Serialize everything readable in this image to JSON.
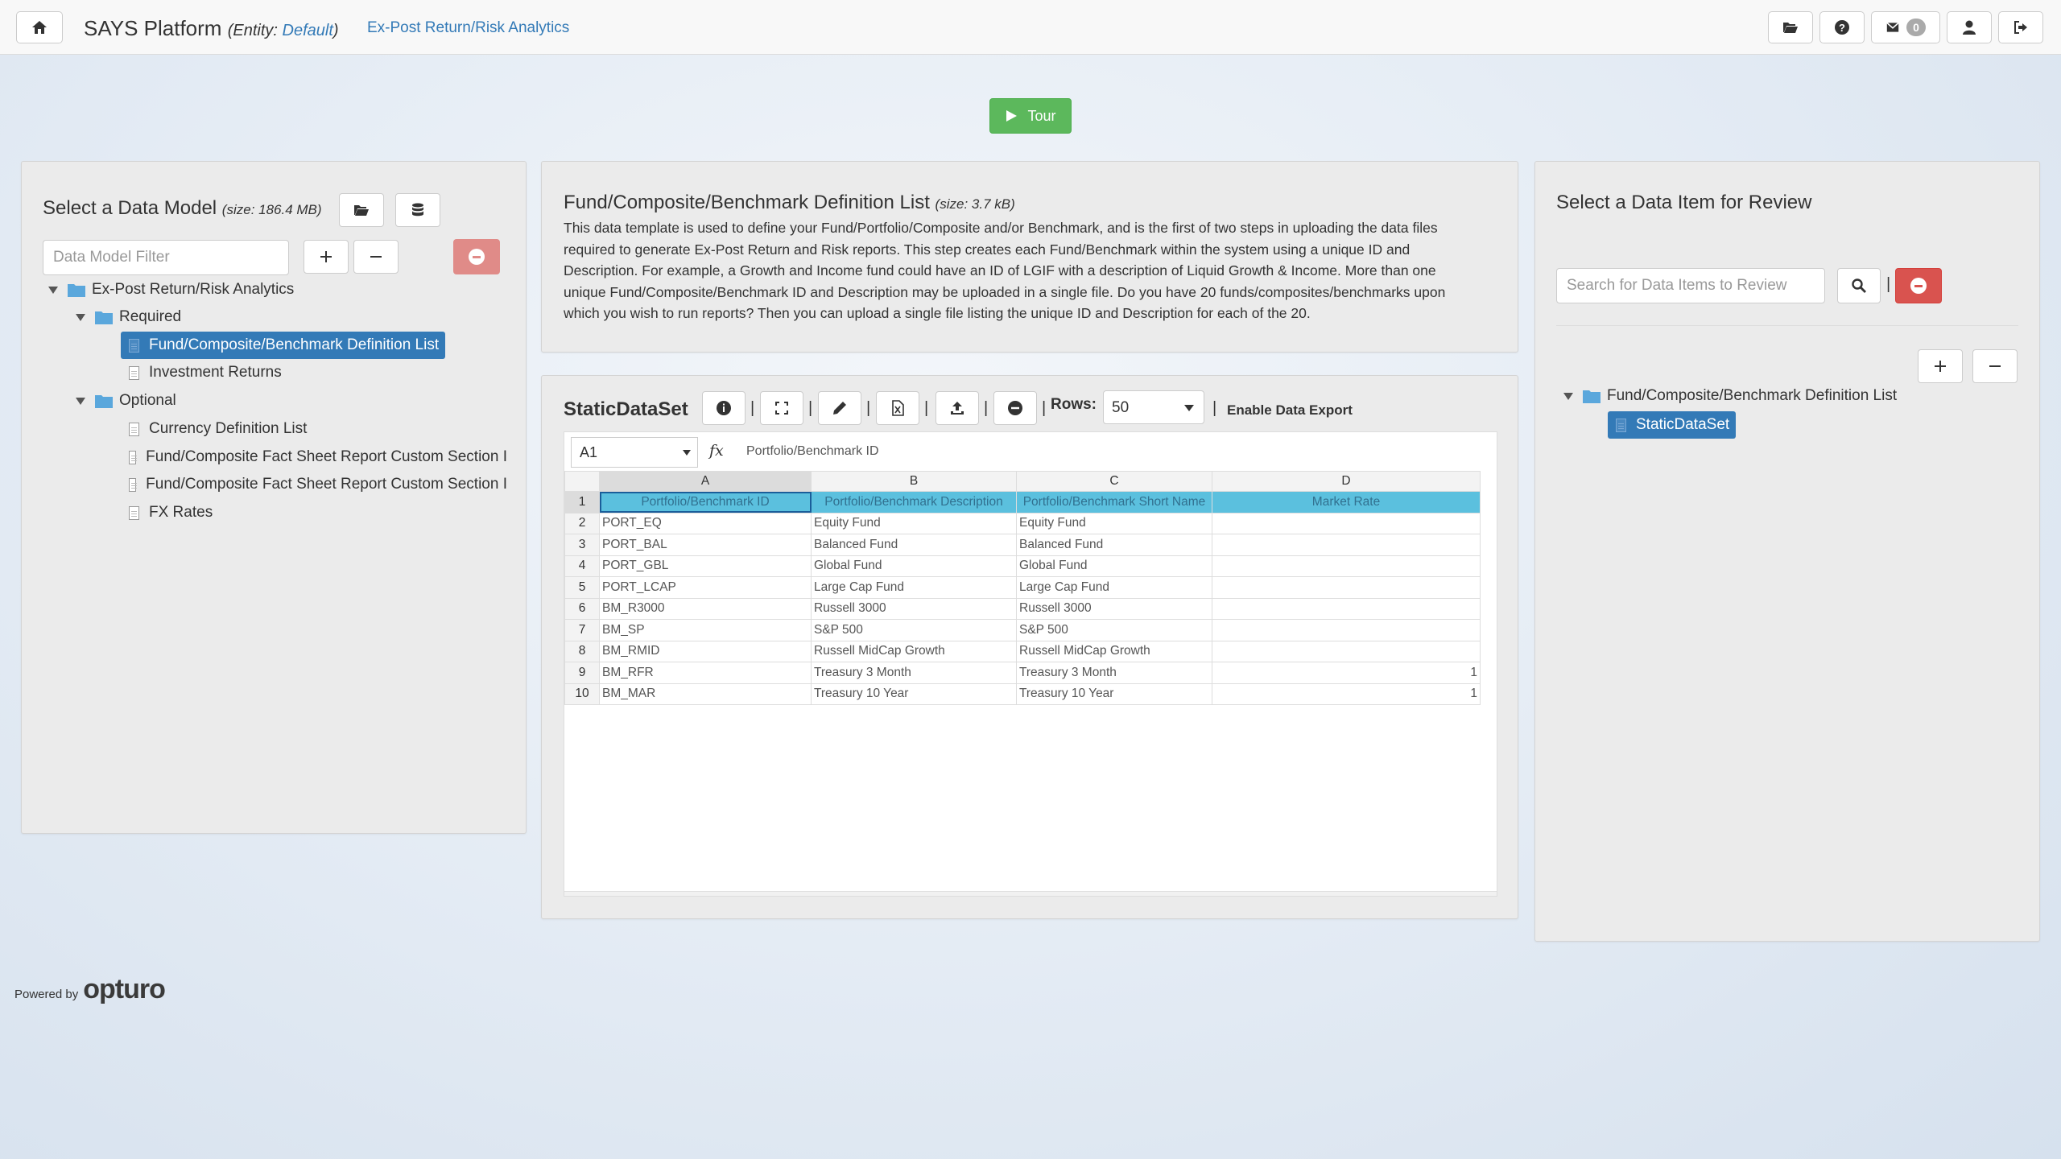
{
  "navbar": {
    "brand": "SAYS Platform",
    "entity_prefix": "(Entity: ",
    "entity_value": "Default",
    "entity_suffix": ")",
    "breadcrumb": "Ex-Post Return/Risk Analytics",
    "mail_count": "0"
  },
  "tour": {
    "label": "Tour"
  },
  "left_panel": {
    "title": "Select a Data Model",
    "size": "(size: 186.4 MB)",
    "filter_placeholder": "Data Model Filter",
    "tree": [
      {
        "label": "Ex-Post Return/Risk Analytics",
        "type": "folder"
      },
      {
        "label": "Required",
        "type": "folder"
      },
      {
        "label": "Fund/Composite/Benchmark Definition List",
        "type": "file",
        "selected": true
      },
      {
        "label": "Investment Returns",
        "type": "file"
      },
      {
        "label": "Optional",
        "type": "folder"
      },
      {
        "label": "Currency Definition List",
        "type": "file"
      },
      {
        "label": "Fund/Composite Fact Sheet Report Custom Section I",
        "type": "file"
      },
      {
        "label": "Fund/Composite Fact Sheet Report Custom Section I",
        "type": "file"
      },
      {
        "label": "FX Rates",
        "type": "file"
      }
    ]
  },
  "center_panel": {
    "title": "Fund/Composite/Benchmark Definition List",
    "size": "(size: 3.7 kB)",
    "description": "This data template is used to define your Fund/Portfolio/Composite and/or Benchmark, and is the first of two steps in uploading the data files required to generate Ex-Post Return and Risk reports. This step creates each Fund/Benchmark within the system using a unique ID and Description. For example, a Growth and Income fund could have an ID of LGIF with a description of Liquid Growth & Income. More than one unique Fund/Composite/Benchmark ID and Description may be uploaded in a single file. Do you have 20 funds/composites/benchmarks upon which you wish to run reports? Then you can upload a single file listing the unique ID and Description for each of the 20.",
    "dataset_title": "StaticDataSet",
    "separator": "|",
    "rows_label": "Rows:",
    "rows_value": "50",
    "export_label": "Enable Data Export"
  },
  "spreadsheet": {
    "cell_ref": "A1",
    "fx": "fx",
    "formula": "Portfolio/Benchmark ID",
    "columns": [
      "A",
      "B",
      "C",
      "D"
    ],
    "rows": [
      {
        "n": "1",
        "cells": [
          "Portfolio/Benchmark ID",
          "Portfolio/Benchmark Description",
          "Portfolio/Benchmark Short Name",
          "Market Rate"
        ]
      },
      {
        "n": "2",
        "cells": [
          "PORT_EQ",
          "Equity Fund",
          "Equity Fund",
          ""
        ]
      },
      {
        "n": "3",
        "cells": [
          "PORT_BAL",
          "Balanced Fund",
          "Balanced Fund",
          ""
        ]
      },
      {
        "n": "4",
        "cells": [
          "PORT_GBL",
          "Global Fund",
          "Global Fund",
          ""
        ]
      },
      {
        "n": "5",
        "cells": [
          "PORT_LCAP",
          "Large Cap Fund",
          "Large Cap Fund",
          ""
        ]
      },
      {
        "n": "6",
        "cells": [
          "BM_R3000",
          "Russell 3000",
          "Russell 3000",
          ""
        ]
      },
      {
        "n": "7",
        "cells": [
          "BM_SP",
          "S&P 500",
          "S&P 500",
          ""
        ]
      },
      {
        "n": "8",
        "cells": [
          "BM_RMID",
          "Russell MidCap Growth",
          "Russell MidCap Growth",
          ""
        ]
      },
      {
        "n": "9",
        "cells": [
          "BM_RFR",
          "Treasury 3 Month",
          "Treasury 3 Month",
          "1"
        ]
      },
      {
        "n": "10",
        "cells": [
          "BM_MAR",
          "Treasury 10 Year",
          "Treasury 10 Year",
          "1"
        ]
      }
    ]
  },
  "right_panel": {
    "title": "Select a Data Item for Review",
    "search_placeholder": "Search for Data Items to Review",
    "separator": "|",
    "tree": [
      {
        "label": "Fund/Composite/Benchmark Definition List",
        "type": "folder"
      },
      {
        "label": "StaticDataSet",
        "type": "file",
        "selected": true
      }
    ]
  },
  "footer": {
    "powered_by": "Powered by",
    "logo": "opturo"
  },
  "colors": {
    "accent": "#337ab7",
    "success": "#5cb85c",
    "danger": "#d9534f",
    "header_cell": "#5bc0de"
  }
}
